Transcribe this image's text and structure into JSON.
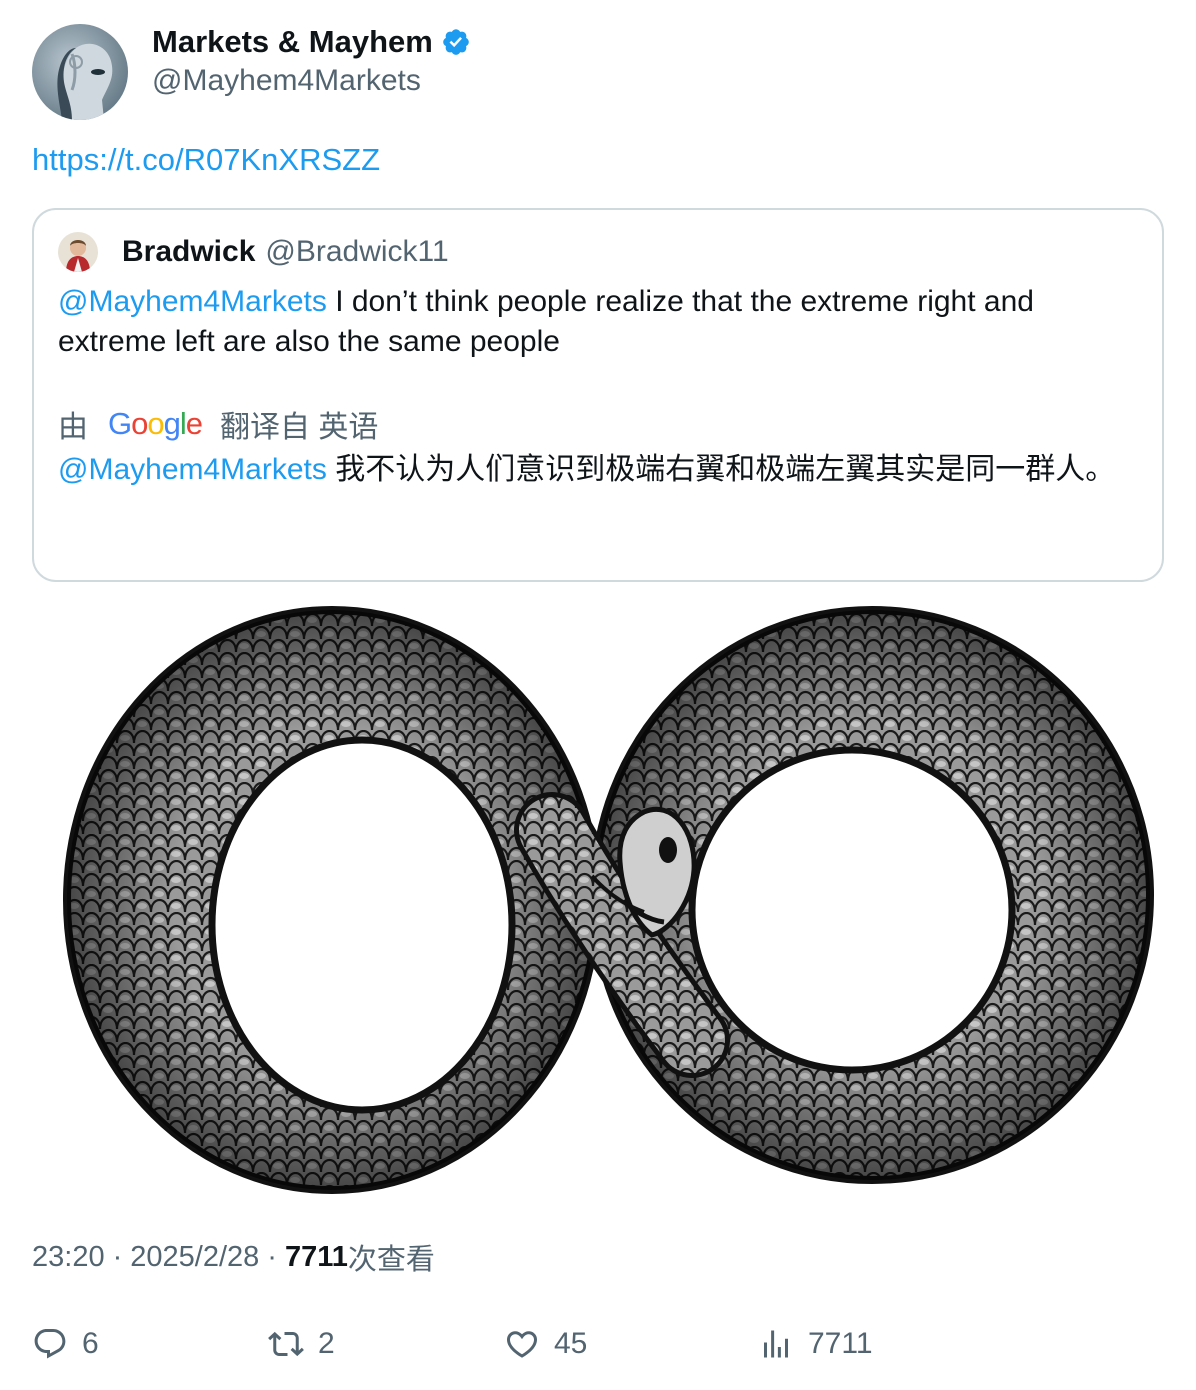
{
  "author": {
    "display_name": "Markets & Mayhem",
    "handle": "@Mayhem4Markets",
    "verified_icon": "verified-badge-icon"
  },
  "tweet": {
    "link": "https://t.co/R07KnXRSZZ"
  },
  "quoted": {
    "display_name": "Bradwick",
    "handle": "@Bradwick11",
    "mention": "@Mayhem4Markets",
    "text": " I don’t think people realize that the extreme right and extreme left are also the same people",
    "translate_prefix": "由",
    "translate_brand": "Google",
    "translate_suffix": "翻译自 英语",
    "translated_mention": "@Mayhem4Markets",
    "translated_text": " 我不认为人们意识到极端右翼和极端左翼其实是同一群人。"
  },
  "meta": {
    "time": "23:20",
    "dot1": "·",
    "date": "2025/2/28",
    "dot2": "·",
    "views": "7711",
    "views_label": "次查看"
  },
  "actions": {
    "replies": "6",
    "reposts": "2",
    "likes": "45",
    "views": "7711"
  },
  "colors": {
    "link": "#1d9bf0",
    "secondary_text": "#536471",
    "primary_text": "#0f1419",
    "border": "#cfd9de"
  }
}
